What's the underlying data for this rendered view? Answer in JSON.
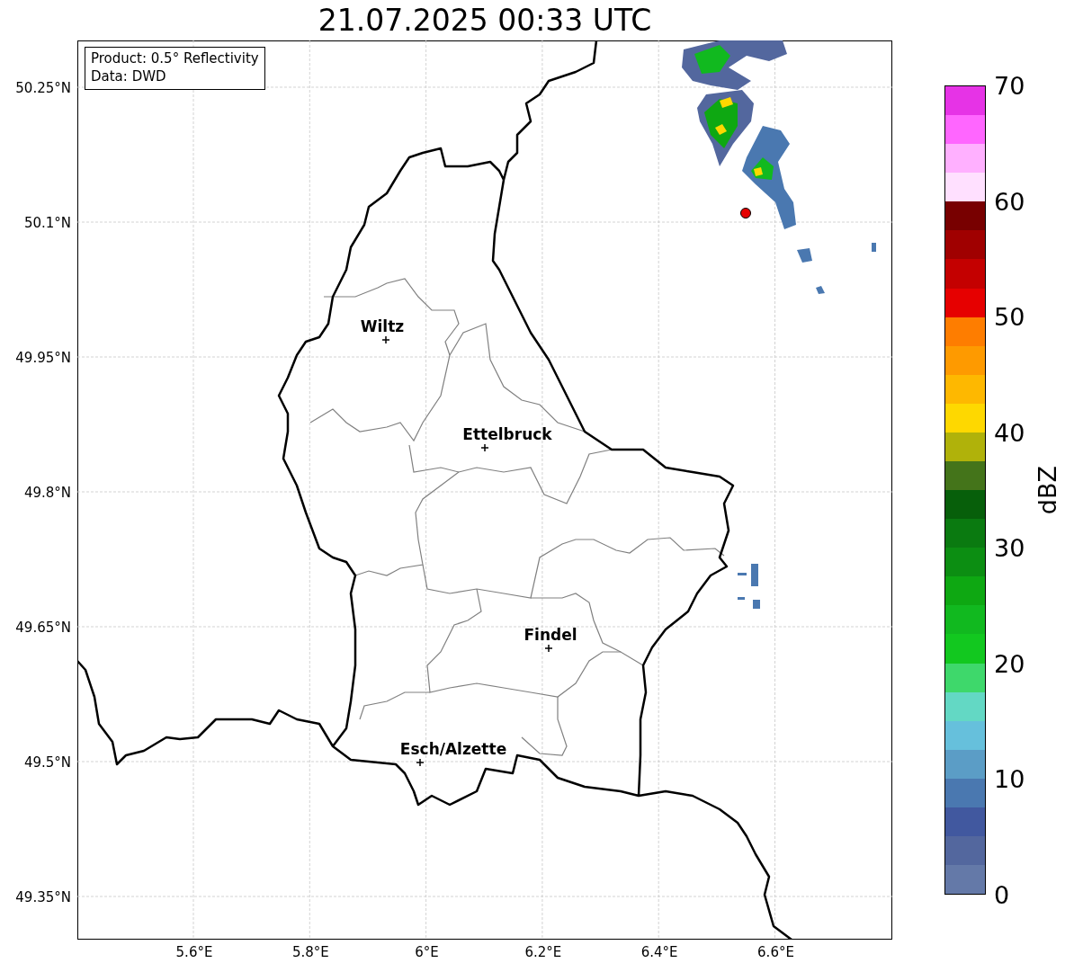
{
  "title": "21.07.2025 00:33 UTC",
  "info_box": [
    "Product: 0.5° Reflectivity",
    "Data: DWD"
  ],
  "y_ticks": [
    "50.25°N",
    "50.1°N",
    "49.95°N",
    "49.8°N",
    "49.65°N",
    "49.5°N",
    "49.35°N"
  ],
  "x_ticks": [
    "5.6°E",
    "5.8°E",
    "6°E",
    "6.2°E",
    "6.4°E",
    "6.6°E"
  ],
  "cities": [
    {
      "name": "Wiltz"
    },
    {
      "name": "Ettelbruck"
    },
    {
      "name": "Findel"
    },
    {
      "name": "Esch/Alzette"
    }
  ],
  "colorbar": {
    "label": "dBZ",
    "ticks": [
      "70",
      "60",
      "50",
      "40",
      "30",
      "20",
      "10",
      "0"
    ],
    "bands": [
      {
        "color": "#e633e6"
      },
      {
        "color": "#ff66ff"
      },
      {
        "color": "#ffb0ff"
      },
      {
        "color": "#ffe0ff"
      },
      {
        "color": "#780000"
      },
      {
        "color": "#a00000"
      },
      {
        "color": "#c40000"
      },
      {
        "color": "#e60000"
      },
      {
        "color": "#fe7d00"
      },
      {
        "color": "#fe9a00"
      },
      {
        "color": "#feb800"
      },
      {
        "color": "#fed800"
      },
      {
        "color": "#b0b20a"
      },
      {
        "color": "#44741a"
      },
      {
        "color": "#075f0a"
      },
      {
        "color": "#0a7a10"
      },
      {
        "color": "#0c8e12"
      },
      {
        "color": "#0ea812"
      },
      {
        "color": "#11b91f"
      },
      {
        "color": "#12c81f"
      },
      {
        "color": "#3ed86b"
      },
      {
        "color": "#63d8c4"
      },
      {
        "color": "#66c0dc"
      },
      {
        "color": "#5b9dc6"
      },
      {
        "color": "#4a78b0"
      },
      {
        "color": "#41589f"
      },
      {
        "color": "#53679e"
      },
      {
        "color": "#6479a8"
      }
    ]
  }
}
